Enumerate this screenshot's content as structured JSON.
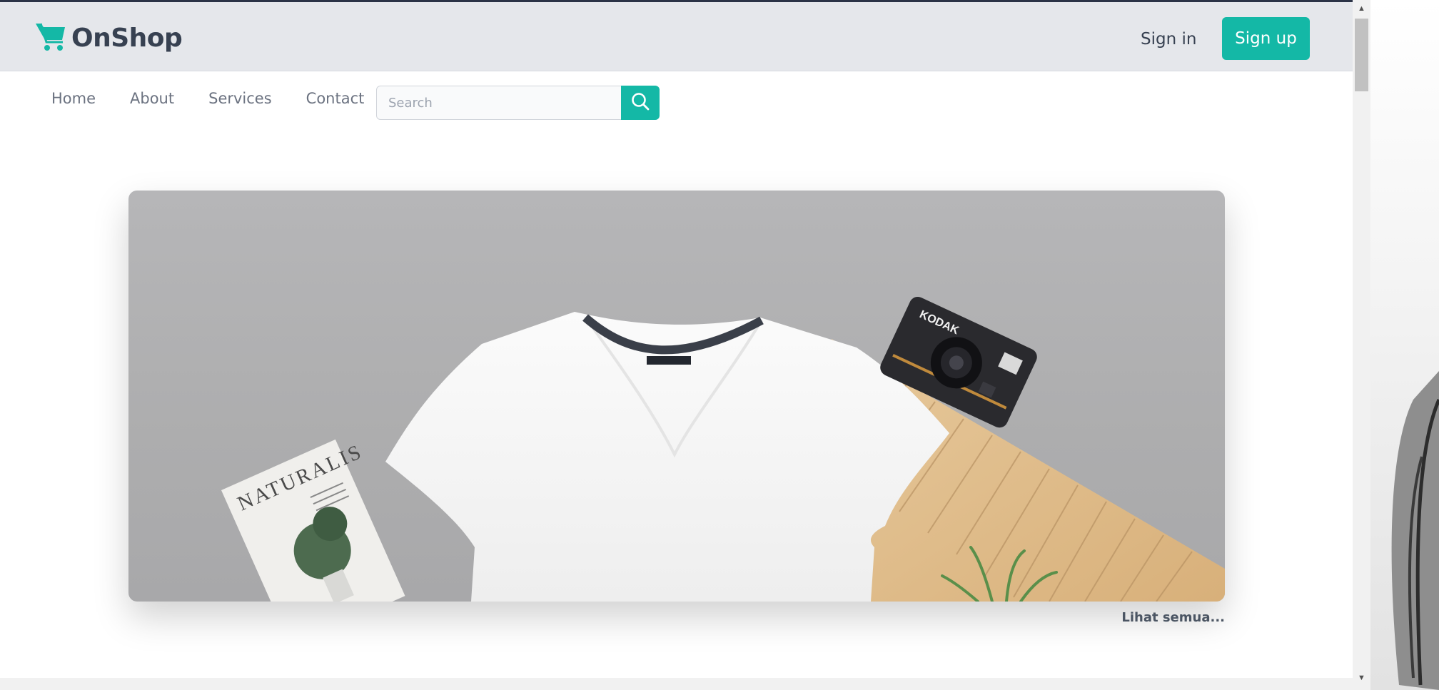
{
  "header": {
    "brand": "OnShop",
    "sign_in_label": "Sign in",
    "sign_up_label": "Sign up"
  },
  "nav": {
    "items": [
      {
        "label": "Home"
      },
      {
        "label": "About"
      },
      {
        "label": "Services"
      },
      {
        "label": "Contact"
      }
    ]
  },
  "search": {
    "placeholder": "Search",
    "value": ""
  },
  "hero": {
    "magazine_title": "NATURALIS",
    "camera_brand": "KODAK"
  },
  "see_all_label": "Lihat semua...",
  "colors": {
    "accent": "#14b8a6",
    "header_bg": "#e5e7eb",
    "text_dark": "#374151",
    "text_muted": "#6b7280"
  },
  "icons": {
    "logo": "shopping-cart-icon",
    "search": "search-icon"
  }
}
